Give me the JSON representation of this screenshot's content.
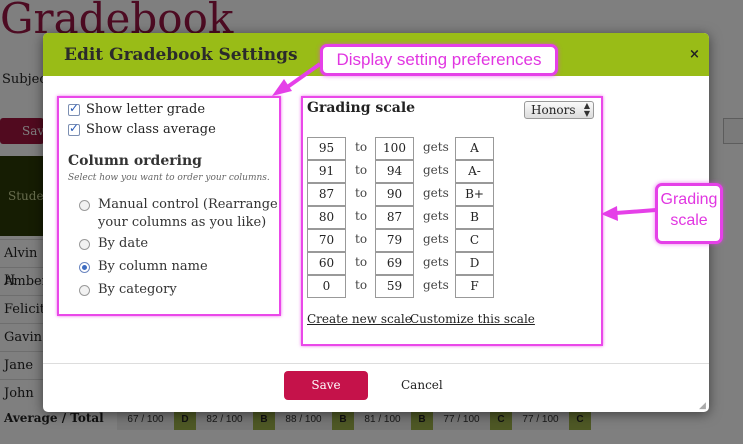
{
  "background": {
    "page_title": "Gradebook",
    "subject_label": "Subject",
    "save_button": "Save",
    "student_header": "Student",
    "students": [
      "Alvin H",
      "Amber",
      "Felicit",
      "Gavin",
      "Jane",
      "John"
    ],
    "average_label": "Average / Total",
    "totals": [
      {
        "score": "67 / 100",
        "grade": "D"
      },
      {
        "score": "82 / 100",
        "grade": "B"
      },
      {
        "score": "88 / 100",
        "grade": "B"
      },
      {
        "score": "81 / 100",
        "grade": "B"
      },
      {
        "score": "77 / 100",
        "grade": "C"
      },
      {
        "score": "77 / 100",
        "grade": "C"
      }
    ]
  },
  "modal": {
    "title": "Edit Gradebook Settings",
    "close_label": "×",
    "checkboxes": [
      {
        "label": "Show letter grade",
        "checked": true
      },
      {
        "label": "Show class average",
        "checked": true
      }
    ],
    "column_ordering": {
      "title": "Column ordering",
      "subtitle": "Select how you want to order your columns.",
      "options": [
        {
          "line1": "Manual control (Rearrange",
          "line2": "your columns as you like)",
          "selected": false
        },
        {
          "line1": "By date",
          "line2": "",
          "selected": false
        },
        {
          "line1": "By column name",
          "line2": "",
          "selected": true
        },
        {
          "line1": "By category",
          "line2": "",
          "selected": false
        }
      ]
    },
    "grading_scale": {
      "title": "Grading scale",
      "selected_scale": "Honors",
      "to_label": "to",
      "gets_label": "gets",
      "rows": [
        {
          "from": "95",
          "to": "100",
          "grade": "A"
        },
        {
          "from": "91",
          "to": "94",
          "grade": "A-"
        },
        {
          "from": "87",
          "to": "90",
          "grade": "B+"
        },
        {
          "from": "80",
          "to": "87",
          "grade": "B"
        },
        {
          "from": "70",
          "to": "79",
          "grade": "C"
        },
        {
          "from": "60",
          "to": "69",
          "grade": "D"
        },
        {
          "from": "0",
          "to": "59",
          "grade": "F"
        }
      ],
      "create_link": "Create new scale",
      "customize_link": "Customize this scale"
    },
    "save_button": "Save",
    "cancel_button": "Cancel"
  },
  "annotations": {
    "display_prefs": "Display setting preferences",
    "grading_scale_line1": "Grading",
    "grading_scale_line2": "scale"
  },
  "colors": {
    "header_green": "#99bc17",
    "accent_crimson": "#c5124a",
    "annotation_magenta": "#e540e8"
  }
}
